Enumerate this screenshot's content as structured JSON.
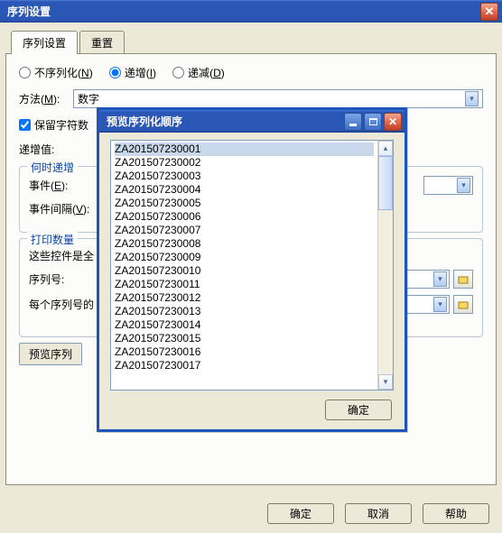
{
  "window": {
    "title": "序列设置"
  },
  "tabs": {
    "active": "序列设置",
    "other": "重置"
  },
  "mode": {
    "opt1": {
      "label": "不序列化",
      "accel": "N"
    },
    "opt2": {
      "label": "递增",
      "accel": "I"
    },
    "opt3": {
      "label": "递减",
      "accel": "D"
    }
  },
  "method": {
    "label": "方法",
    "accel": "M",
    "value": "数字"
  },
  "preserve": {
    "label": "保留字符数"
  },
  "incr": {
    "label": "递增值:"
  },
  "when_group": {
    "legend": "何时递增",
    "event": {
      "label": "事件",
      "accel": "E"
    },
    "interval": {
      "label": "事件间隔",
      "accel": "V"
    }
  },
  "qty_group": {
    "legend": "打印数量",
    "static": "这些控件是全",
    "seq_label": "序列号:",
    "each_label": "每个序列号的"
  },
  "preview_btn": "预览序列",
  "footer": {
    "ok": "确定",
    "cancel": "取消",
    "help": "帮助"
  },
  "preview_dlg": {
    "title": "预览序列化顺序",
    "ok": "确定",
    "items": [
      "ZA201507230001",
      "ZA201507230002",
      "ZA201507230003",
      "ZA201507230004",
      "ZA201507230005",
      "ZA201507230006",
      "ZA201507230007",
      "ZA201507230008",
      "ZA201507230009",
      "ZA201507230010",
      "ZA201507230011",
      "ZA201507230012",
      "ZA201507230013",
      "ZA201507230014",
      "ZA201507230015",
      "ZA201507230016",
      "ZA201507230017"
    ]
  }
}
